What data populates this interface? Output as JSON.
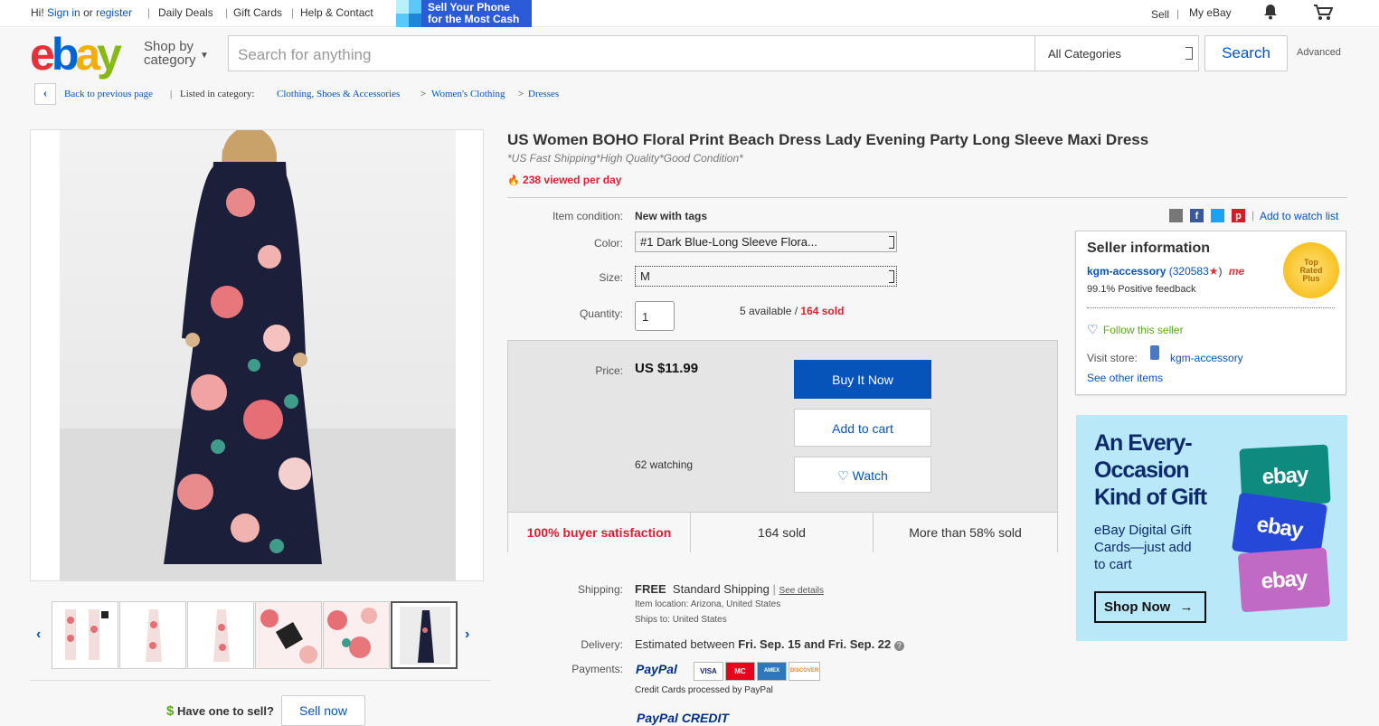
{
  "topbar": {
    "hi": "Hi!",
    "sign_in": "Sign in",
    "or": "or",
    "register": "register",
    "daily_deals": "Daily Deals",
    "gift_cards": "Gift Cards",
    "help_contact": "Help & Contact",
    "promo_line1": "Sell Your Phone",
    "promo_line2": "for the Most Cash",
    "sell": "Sell",
    "my_ebay": "My eBay"
  },
  "header": {
    "logo": [
      "e",
      "b",
      "a",
      "y"
    ],
    "shop_by_line1": "Shop by",
    "shop_by_line2": "category",
    "search_placeholder": "Search for anything",
    "category_select": "All Categories",
    "search_button": "Search",
    "advanced": "Advanced"
  },
  "breadcrumb": {
    "back": "Back to previous page",
    "listed_in": "Listed in category:",
    "items": [
      "Clothing, Shoes & Accessories",
      "Women's Clothing",
      "Dresses"
    ],
    "sep": ">"
  },
  "listing": {
    "title": "US Women BOHO Floral Print Beach Dress Lady Evening Party Long Sleeve Maxi Dress",
    "subtitle": "*US Fast Shipping*High Quality*Good Condition*",
    "views": "238 viewed per day",
    "condition_label": "Item condition:",
    "condition_value": "New with tags",
    "color_label": "Color:",
    "color_value": "#1 Dark Blue-Long Sleeve Flora...",
    "size_label": "Size:",
    "size_value": "M",
    "quantity_label": "Quantity:",
    "quantity_value": "1",
    "available": "5 available",
    "slash": "/",
    "sold_count": "164 sold",
    "price_label": "Price:",
    "price": "US $11.99",
    "buy_now": "Buy It Now",
    "add_to_cart": "Add to cart",
    "watch": "Watch",
    "watching": "62 watching",
    "stat_satisfaction": "100% buyer satisfaction",
    "stat_sold": "164 sold",
    "stat_percent": "More than 58% sold",
    "add_watch_list": "Add to watch list"
  },
  "shipping": {
    "shipping_label": "Shipping:",
    "free": "FREE",
    "method": "Standard Shipping",
    "see_details": "See details",
    "location": "Item location:  Arizona, United States",
    "ships_to": "Ships to:  United States",
    "delivery_label": "Delivery:",
    "delivery_prefix": "Estimated between",
    "delivery_dates": "Fri. Sep. 15 and Fri. Sep. 22",
    "payments_label": "Payments:",
    "paypal": "PayPal",
    "cards": [
      "VISA",
      "MC",
      "AMEX",
      "DISCOVER"
    ],
    "credit_note": "Credit Cards processed by PayPal",
    "paypal_credit": "PayPal CREDIT"
  },
  "seller": {
    "heading": "Seller information",
    "name": "kgm-accessory",
    "score": "(320583",
    "score_close": ")",
    "me": "me",
    "feedback": "99.1% Positive feedback",
    "follow": "Follow this seller",
    "visit_store": "Visit store:",
    "store_name": "kgm-accessory",
    "other_items": "See other items",
    "badge": [
      "Top",
      "Rated",
      "Plus"
    ]
  },
  "ad": {
    "headline1": "An Every-",
    "headline2": "Occasion",
    "headline3": "Kind of Gift",
    "body1": "eBay Digital Gift",
    "body2": "Cards—just add",
    "body3": "to cart",
    "cta": "Shop Now",
    "card_label": "ebay"
  },
  "sell_prompt": {
    "question": "Have one to sell?",
    "button": "Sell now"
  },
  "colors": {
    "link": "#0654ba",
    "accent_red": "#dd1e31",
    "primary_button": "#0654ba"
  }
}
